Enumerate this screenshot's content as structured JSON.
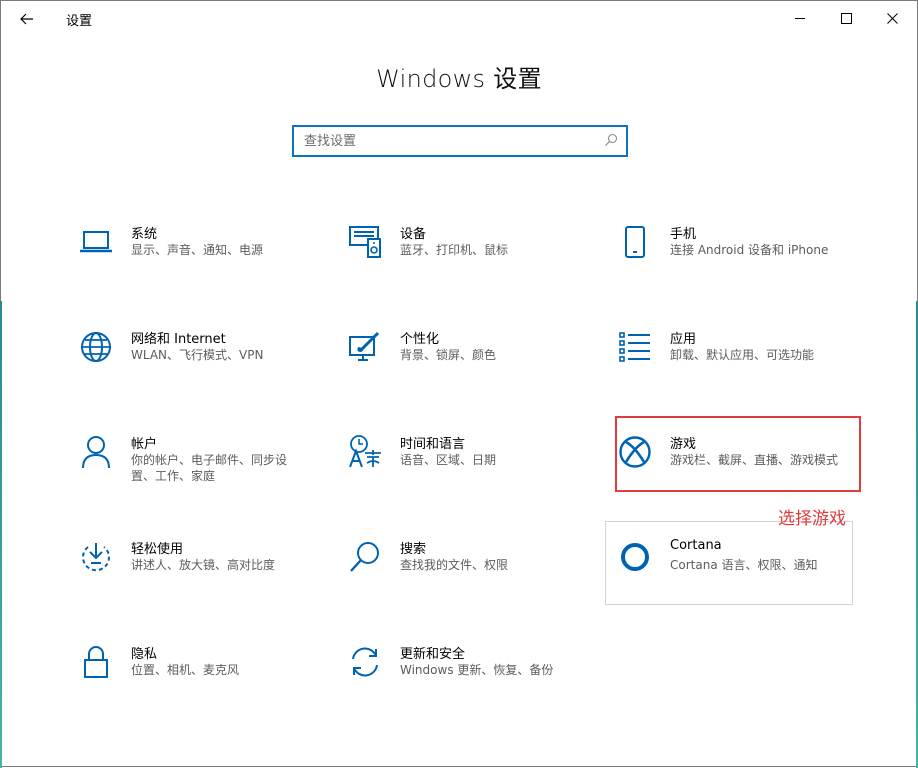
{
  "window": {
    "title": "设置"
  },
  "page_title": "Windows 设置",
  "search": {
    "placeholder": "查找设置"
  },
  "tiles": [
    {
      "title": "系统",
      "subtitle": "显示、声音、通知、电源",
      "icon": "laptop-icon"
    },
    {
      "title": "设备",
      "subtitle": "蓝牙、打印机、鼠标",
      "icon": "devices-icon"
    },
    {
      "title": "手机",
      "subtitle": "连接 Android 设备和 iPhone",
      "icon": "phone-icon"
    },
    {
      "title": "网络和 Internet",
      "subtitle": "WLAN、飞行模式、VPN",
      "icon": "globe-icon"
    },
    {
      "title": "个性化",
      "subtitle": "背景、锁屏、颜色",
      "icon": "paint-icon"
    },
    {
      "title": "应用",
      "subtitle": "卸载、默认应用、可选功能",
      "icon": "apps-list-icon"
    },
    {
      "title": "帐户",
      "subtitle": "你的帐户、电子邮件、同步设置、工作、家庭",
      "icon": "person-icon"
    },
    {
      "title": "时间和语言",
      "subtitle": "语音、区域、日期",
      "icon": "time-language-icon"
    },
    {
      "title": "游戏",
      "subtitle": "游戏栏、截屏、直播、游戏模式",
      "icon": "xbox-icon"
    },
    {
      "title": "轻松使用",
      "subtitle": "讲述人、放大镜、高对比度",
      "icon": "ease-of-access-icon"
    },
    {
      "title": "搜索",
      "subtitle": "查找我的文件、权限",
      "icon": "search-icon"
    },
    {
      "title": "Cortana",
      "subtitle": "Cortana 语言、权限、通知",
      "icon": "cortana-icon"
    },
    {
      "title": "隐私",
      "subtitle": "位置、相机、麦克风",
      "icon": "lock-icon"
    },
    {
      "title": "更新和安全",
      "subtitle": "Windows 更新、恢复、备份",
      "icon": "update-icon"
    }
  ],
  "annotation": {
    "text": "选择游戏",
    "color": "#e03c3c"
  },
  "colors": {
    "accent": "#0d74bf",
    "icon": "#0063b1",
    "highlight": "#e03c3c"
  }
}
